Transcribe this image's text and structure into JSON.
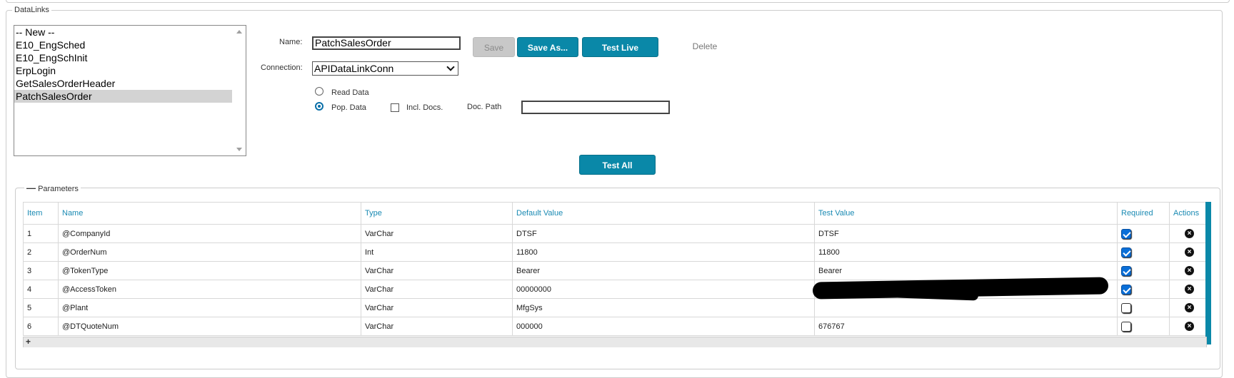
{
  "section_title": "DataLinks",
  "datalinks_list": [
    {
      "label": "-- New --",
      "selected": false
    },
    {
      "label": "E10_EngSched",
      "selected": false
    },
    {
      "label": "E10_EngSchInit",
      "selected": false
    },
    {
      "label": "ErpLogin",
      "selected": false
    },
    {
      "label": "GetSalesOrderHeader",
      "selected": false
    },
    {
      "label": "PatchSalesOrder",
      "selected": true
    }
  ],
  "form": {
    "name_label": "Name:",
    "name_value": "PatchSalesOrder",
    "connection_label": "Connection:",
    "connection_value": "APIDataLinkConn",
    "read_data_label": "Read Data",
    "pop_data_label": "Pop. Data",
    "incl_docs_label": "Incl. Docs.",
    "doc_path_label": "Doc. Path",
    "doc_path_value": ""
  },
  "buttons": {
    "save": "Save",
    "save_as": "Save As...",
    "test_live": "Test Live",
    "delete": "Delete",
    "test_all": "Test All"
  },
  "parameters": {
    "legend": "Parameters",
    "collapse_icon": "minus-icon",
    "columns": [
      "Item",
      "Name",
      "Type",
      "Default Value",
      "Test Value",
      "Required",
      "Actions"
    ],
    "rows": [
      {
        "item": "1",
        "name": "@CompanyId",
        "type": "VarChar",
        "default": "DTSF",
        "test": "DTSF",
        "required": true
      },
      {
        "item": "2",
        "name": "@OrderNum",
        "type": "Int",
        "default": "11800",
        "test": "11800",
        "required": true
      },
      {
        "item": "3",
        "name": "@TokenType",
        "type": "VarChar",
        "default": "Bearer",
        "test": "Bearer",
        "required": true
      },
      {
        "item": "4",
        "name": "@AccessToken",
        "type": "VarChar",
        "default": "00000000",
        "test": "",
        "required": true
      },
      {
        "item": "5",
        "name": "@Plant",
        "type": "VarChar",
        "default": "MfgSys",
        "test": "",
        "required": false
      },
      {
        "item": "6",
        "name": "@DTQuoteNum",
        "type": "VarChar",
        "default": "000000",
        "test": "676767",
        "required": false
      }
    ],
    "add_row_icon": "plus-icon"
  },
  "colors": {
    "accent": "#0a88a8",
    "header_text": "#1a8ab3",
    "selected_item": "#d3d3d3"
  }
}
